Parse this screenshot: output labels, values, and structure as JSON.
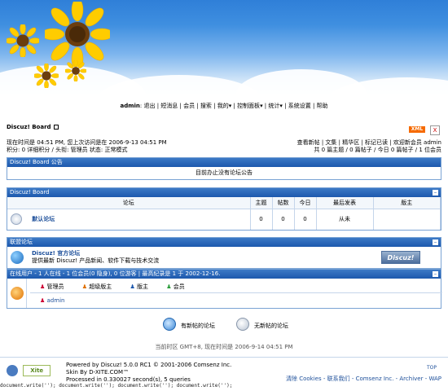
{
  "nav": {
    "user": "admin",
    "items": [
      "退出",
      "短消息",
      "会员",
      "搜索",
      "我的",
      "控制面板",
      "统计",
      "系统设置",
      "帮助"
    ]
  },
  "forum_title": "Discuz! Board",
  "xml_label": "XML",
  "close_label": "X",
  "info": {
    "time_line": "现在时间是 04:51 PM, 您上次访问是在 2006-9-13 04:51 PM",
    "points_line": "积分: 0 详细积分 / 头衔: 管理员 状态: 正常模式",
    "right_links": "查看新帖 | 文集 | 精华区 | 标记已读 | 欢迎新会员 admin",
    "right_stats": "共 0 篇主题 / 0 篇帖子 / 今日 0 篇帖子 / 1 位会员"
  },
  "announce": {
    "title": "Discuz! Board 公告",
    "text": "目前办止没有论坛公告"
  },
  "board": {
    "title": "Discuz! Board",
    "columns": [
      "论坛",
      "主题",
      "帖数",
      "今日",
      "最后发表",
      "版主"
    ],
    "rows": [
      {
        "name": "默认论坛",
        "topics": "0",
        "posts": "0",
        "today": "0",
        "last": "从未",
        "mod": ""
      }
    ]
  },
  "links": {
    "title": "联盟论坛",
    "name": "Discuz! 官方论坛",
    "desc": "提供最新 Discuz! 产品新闻、软件下载与技术交流",
    "logo": "Discuz!"
  },
  "online": {
    "title": "在线用户 - 1 人在线 - 1 位会员(0 隐身), 0 位游客 | 最高纪录是 1 于 2002-12-16.",
    "groups": [
      "管理员",
      "超级版主",
      "版主",
      "会员"
    ],
    "users": [
      "admin"
    ]
  },
  "legend": {
    "new": "有新帖的论坛",
    "nonew": "无新帖的论坛"
  },
  "timezone": "当前时区 GMT+8, 现在时间是 2006-9-14 04:51 PM",
  "footer": {
    "powered_line": "Powered by Discuz! 5.0.0 RC1 © 2001-2006 Comsenz Inc.",
    "skin_line": "Skin By D-XITE.COM™",
    "processed_line": "Processed in 0.330027 second(s), 5 queries",
    "links": "清除 Cookies - 联系我们 - Comsenz Inc. - Archiver - WAP",
    "top": "TOP",
    "logo_text": "Xite"
  },
  "docwrite": "document.write(''); document.write(''); document.write(''); document.write('');",
  "colors": {
    "accent": "#1d58ad",
    "head_border": "#7aa3d4"
  }
}
